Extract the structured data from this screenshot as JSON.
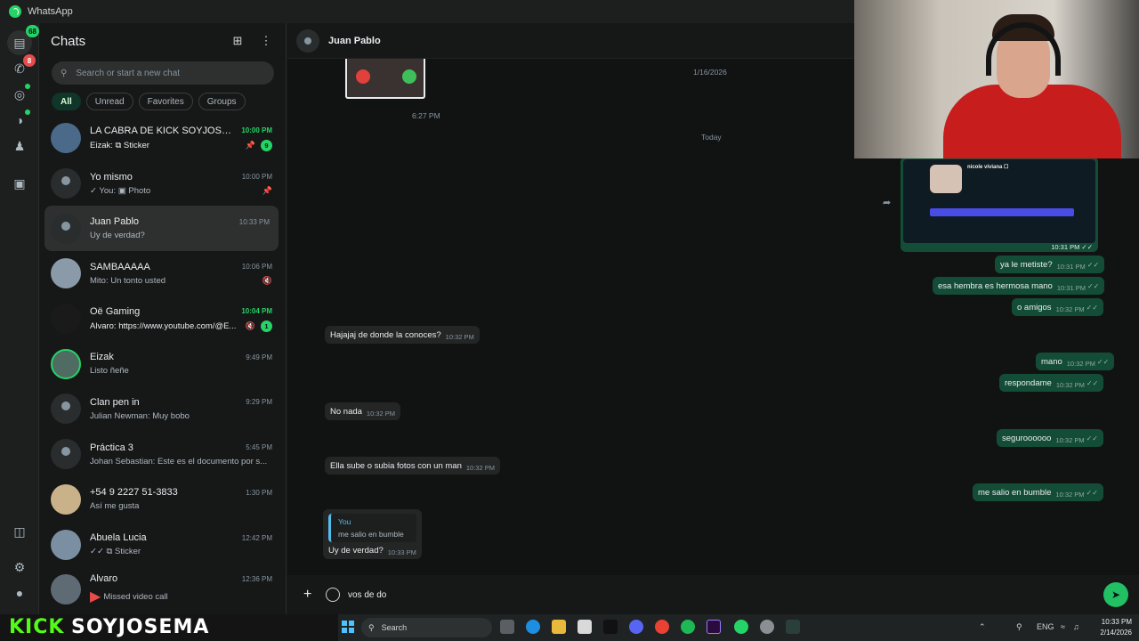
{
  "app": {
    "title": "WhatsApp"
  },
  "rail": {
    "chats_badge": "68",
    "calls_badge": "8"
  },
  "sidebar": {
    "title": "Chats",
    "search_placeholder": "Search or start a new chat",
    "filters": [
      "All",
      "Unread",
      "Favorites",
      "Groups"
    ],
    "chats": [
      {
        "name": "LA CABRA DE KICK SOYJOSEM...",
        "time": "10:00 PM",
        "preview": "Eizak: ⧉ Sticker",
        "unread": "9",
        "time_unread": true
      },
      {
        "name": "Yo mismo",
        "time": "10:00 PM",
        "preview": "✓ You: ▣ Photo"
      },
      {
        "name": "Juan Pablo",
        "time": "10:33 PM",
        "preview": "Uy de verdad?"
      },
      {
        "name": "SAMBAAAAA",
        "time": "10:06 PM",
        "preview": "Mito: Un tonto usted"
      },
      {
        "name": "Oë Gaming",
        "time": "10:04 PM",
        "preview": "Alvaro: https://www.youtube.com/@E...",
        "unread": "1",
        "time_unread": true
      },
      {
        "name": "Eizak",
        "time": "9:49 PM",
        "preview": "Listo ñeñe"
      },
      {
        "name": "Clan pen in",
        "time": "9:29 PM",
        "preview": "Julian Newman: Muy bobo"
      },
      {
        "name": "Práctica 3",
        "time": "5:45 PM",
        "preview": "Johan Sebastian: Este es el documento por s..."
      },
      {
        "name": "+54 9 2227 51-3833",
        "time": "1:30 PM",
        "preview": "Así me gusta"
      },
      {
        "name": "Abuela Lucia",
        "time": "12:42 PM",
        "preview": "✓✓ ⧉ Sticker"
      },
      {
        "name": "Alvaro",
        "time": "12:36 PM",
        "preview": "Missed video call"
      }
    ]
  },
  "chat": {
    "contact_name": "Juan Pablo",
    "call_time": "6:27 PM",
    "date_old": "1/16/2026",
    "date_today": "Today",
    "shared_profile_name": "nicole viviana ☐",
    "shared_time": "10:31 PM ✓✓",
    "messages": [
      {
        "text": "ya le metiste?",
        "time": "10:31 PM"
      },
      {
        "text": "esa hembra es hermosa mano",
        "time": "10:31 PM"
      },
      {
        "text": "o amigos",
        "time": "10:32 PM"
      },
      {
        "text": "Hajajaj de donde la conoces?",
        "time": "10:32 PM"
      },
      {
        "text": "mano",
        "time": "10:32 PM"
      },
      {
        "text": "respondame",
        "time": "10:32 PM"
      },
      {
        "text": "No nada",
        "time": "10:32 PM"
      },
      {
        "text": "seguroooooo",
        "time": "10:32 PM"
      },
      {
        "text": "Ella sube o subia fotos con un man",
        "time": "10:32 PM"
      },
      {
        "text": "me salio en bumble",
        "time": "10:32 PM"
      },
      {
        "text": "Uy de verdad?",
        "time": "10:33 PM"
      }
    ],
    "reply": {
      "who": "You",
      "text": "me salio en bumble"
    },
    "composer_value": "vos de do"
  },
  "branding": {
    "kick": "KICK",
    "user": "SOYJOSEMA"
  },
  "taskbar": {
    "search_label": "Search",
    "lang": "ENG",
    "time": "10:33 PM",
    "date": "2/14/2026"
  },
  "colors": {
    "accent": "#25d366",
    "outgoing": "#144d37",
    "incoming": "#242626",
    "background": "#161717",
    "kick": "#53fc18"
  }
}
